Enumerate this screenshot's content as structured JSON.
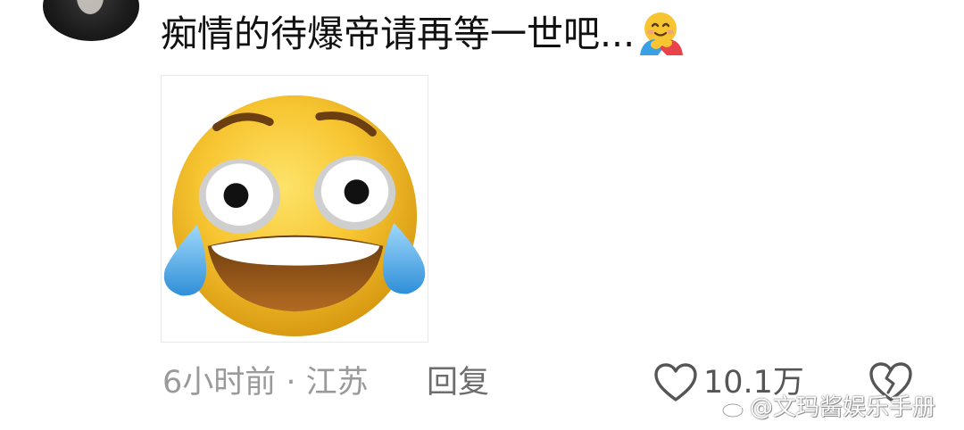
{
  "comment": {
    "text": "痴情的待爆帝请再等一世吧...",
    "inline_emoji": "hugging-face-icon"
  },
  "sticker": {
    "icon": "laughing-crying-face-icon"
  },
  "meta": {
    "time_location": "6小时前 · 江苏",
    "reply_label": "回复",
    "like_count": "10.1万"
  },
  "watermark": {
    "text": "@文玛酱娱乐手册"
  },
  "colors": {
    "meta_text": "#9a9a9a",
    "reply_text": "#6d6d6d",
    "emoji_yellow": "#f7c531",
    "tear_blue": "#4aa8e8"
  }
}
